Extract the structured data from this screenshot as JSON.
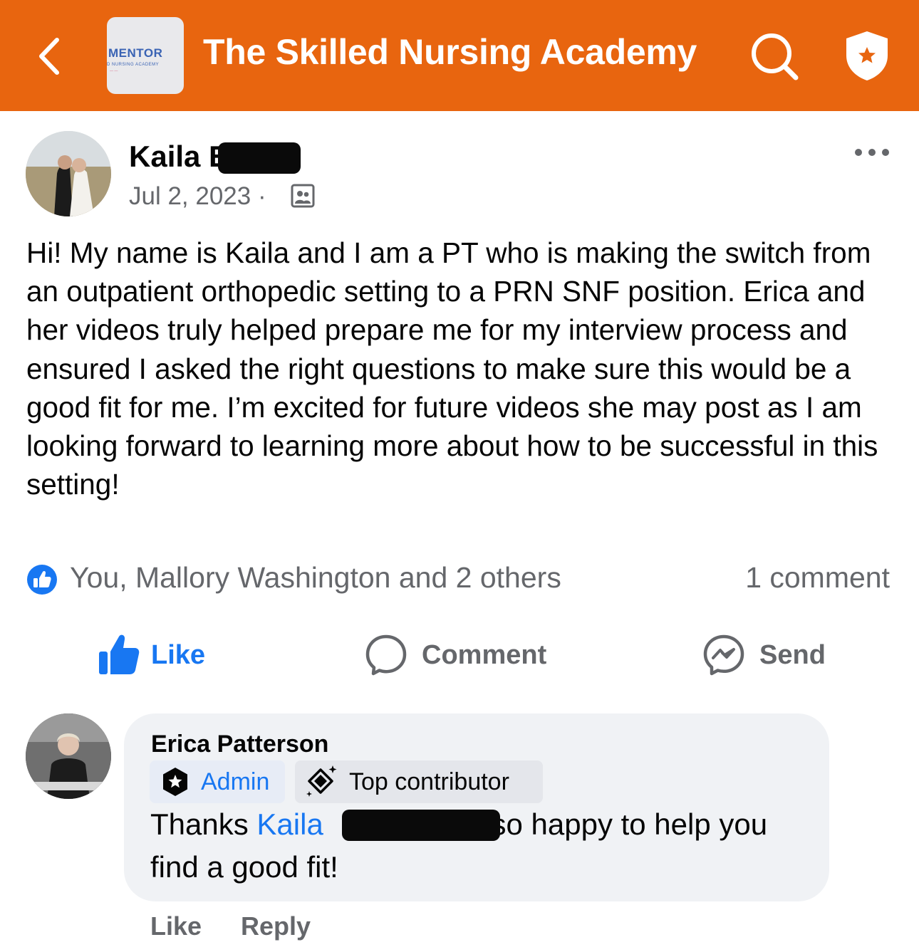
{
  "header": {
    "group_logo_text": "MENTOR",
    "group_logo_subtext": "D NURSING ACADEMY",
    "title": "The Skilled Nursing Academy",
    "background_color": "#e8650f"
  },
  "post": {
    "author": "Kaila E",
    "date": "Jul 2, 2023 ·",
    "body": "Hi! My name is Kaila and I am a PT who is making the switch from an outpatient orthopedic setting to a PRN SNF position. Erica and her videos truly helped prepare me for my interview process and ensured I asked the right questions to make sure this would be a good fit for me. I’m excited for future videos she may post as I am looking forward to learning more about how to be successful in this setting!",
    "reactions_summary": "You, Mallory Washington and 2 others",
    "comment_count": "1 comment"
  },
  "actions": {
    "like": "Like",
    "comment": "Comment",
    "send": "Send"
  },
  "comment": {
    "author": "Erica Patterson",
    "badges": {
      "admin": "Admin",
      "top_contributor": "Top contributor"
    },
    "text_prefix": "Thanks",
    "mention": "Kaila",
    "text_suffix": "so happy to help you find a good fit!",
    "like": "Like",
    "reply": "Reply"
  },
  "icons": [
    "back-icon",
    "search-icon",
    "shield-star-icon",
    "more-icon",
    "audience-group-icon",
    "like-badge-icon",
    "thumbs-up-icon",
    "comment-icon",
    "messenger-icon",
    "admin-star-icon",
    "top-contributor-icon"
  ],
  "colors": {
    "accent": "#1877f2",
    "secondary_text": "#65676b"
  }
}
